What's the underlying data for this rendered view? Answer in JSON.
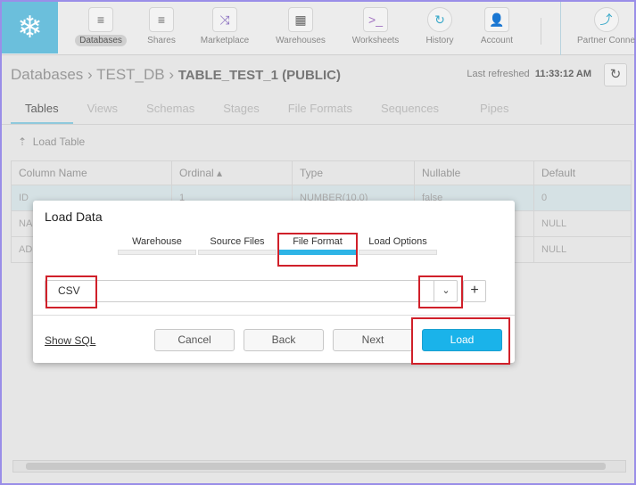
{
  "nav": {
    "items": [
      {
        "label": "Databases",
        "icon": "database-icon",
        "active": true
      },
      {
        "label": "Shares",
        "icon": "share-icon"
      },
      {
        "label": "Marketplace",
        "icon": "shuffle-icon"
      },
      {
        "label": "Warehouses",
        "icon": "warehouse-icon"
      },
      {
        "label": "Worksheets",
        "icon": "terminal-icon"
      },
      {
        "label": "History",
        "icon": "history-icon"
      },
      {
        "label": "Account",
        "icon": "user-icon"
      },
      {
        "label": "Partner Conne",
        "icon": "partner-icon"
      }
    ]
  },
  "breadcrumb": {
    "root": "Databases",
    "db": "TEST_DB",
    "table": "TABLE_TEST_1 (PUBLIC)"
  },
  "refresh": {
    "label": "Last refreshed",
    "time": "11:33:12 AM"
  },
  "tabs": [
    "Tables",
    "Views",
    "Schemas",
    "Stages",
    "File Formats",
    "Sequences",
    "Pipes"
  ],
  "load_table": "Load Table",
  "table": {
    "headers": [
      "Column Name",
      "Ordinal ▴",
      "Type",
      "Nullable",
      "Default"
    ],
    "rows": [
      [
        "ID",
        "1",
        "NUMBER(10,0)",
        "false",
        "0"
      ],
      [
        "NA",
        "",
        "",
        "",
        "NULL"
      ],
      [
        "AD",
        "",
        "",
        "",
        "NULL"
      ]
    ]
  },
  "modal": {
    "title": "Load Data",
    "steps": [
      "Warehouse",
      "Source Files",
      "File Format",
      "Load Options"
    ],
    "active_step": 2,
    "file_format": "CSV",
    "show_sql": "Show SQL",
    "cancel": "Cancel",
    "back": "Back",
    "next": "Next",
    "load": "Load"
  },
  "colors": {
    "accent": "#1ab3ea",
    "highlight": "#d0202a"
  }
}
